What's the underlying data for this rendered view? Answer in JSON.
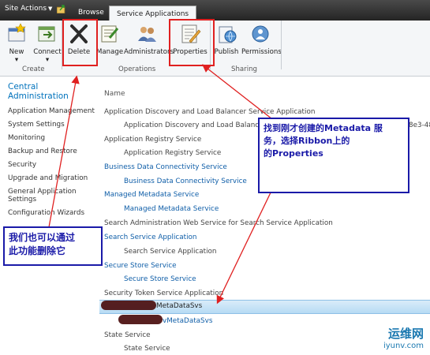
{
  "topbar": {
    "site_actions": "Site Actions",
    "tabs": [
      "Browse",
      "Service Applications"
    ]
  },
  "ribbon": {
    "buttons": [
      "New",
      "Connect",
      "Delete",
      "Manage",
      "Administrators",
      "Properties",
      "Publish",
      "Permissions"
    ],
    "groups": [
      "Create",
      "Operations",
      "Sharing"
    ]
  },
  "leftnav": {
    "title": "Central Administration",
    "items": [
      "Application Management",
      "System Settings",
      "Monitoring",
      "Backup and Restore",
      "Security",
      "Upgrade and Migration",
      "General Application Settings",
      "Configuration Wizards"
    ]
  },
  "content": {
    "column_header": "Name",
    "rows": [
      "Application Discovery and Load Balancer Service Application",
      "Application Discovery and Load Balancer",
      "Application Registry Service",
      "Application Registry Service",
      "Business Data Connectivity Service",
      "Business Data Connectivity Service",
      "Managed Metadata Service",
      "Managed Metadata Service",
      "Search Administration Web Service for Search Service Application",
      "Search Service Application",
      "Search Service Application",
      "Secure Store Service",
      "Secure Store Service",
      "Security Token Service Application",
      "MetaDataSvs",
      "vMetaDataSvs",
      "State Service",
      "State Service"
    ],
    "truncated_guid": "8e3-48"
  },
  "annotations": {
    "right_callout": [
      "找到刚才创建的Metadata 服",
      "务，选择Ribbon上的",
      "的Properties"
    ],
    "left_callout": [
      "我们也可以通过",
      "此功能删除它"
    ]
  },
  "watermark": {
    "cn": "运维网",
    "en": "iyunv.com"
  }
}
